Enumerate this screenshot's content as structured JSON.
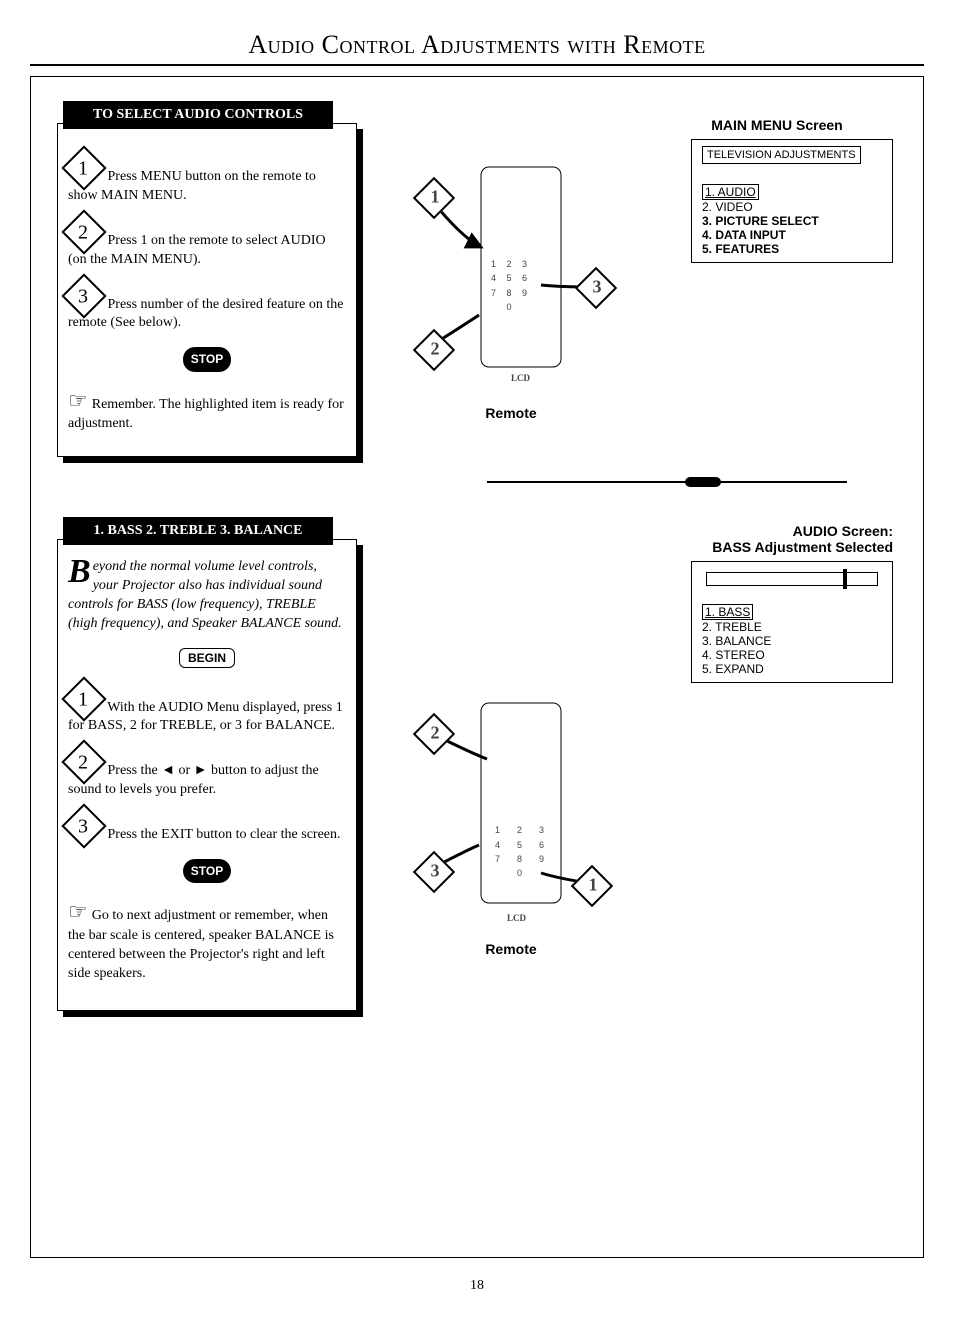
{
  "title": "Audio Control Adjustments with Remote",
  "page_number": "18",
  "section1": {
    "heading": "TO SELECT AUDIO CONTROLS",
    "step1": "Press MENU button on the remote to show MAIN MENU.",
    "step2": "Press 1 on the remote to select AUDIO (on the MAIN MENU).",
    "step3": "Press number of the desired feature on the remote (See below).",
    "stop": "STOP",
    "note": "Remember. The highlighted item is ready for adjustment."
  },
  "main_menu": {
    "label": "MAIN MENU Screen",
    "header": "TELEVISION ADJUSTMENTS",
    "items": [
      "1. AUDIO",
      "2. VIDEO",
      "3. PICTURE SELECT",
      "4. DATA INPUT",
      "5. FEATURES"
    ]
  },
  "remote_label": "Remote",
  "remote_brand": "LCD",
  "section2": {
    "heading": "1. BASS  2. TREBLE  3. BALANCE",
    "intro_dropcap": "B",
    "intro": "eyond the normal volume level controls, your Projector also has individual sound controls for BASS (low frequency), TREBLE (high frequency), and Speaker BALANCE sound.",
    "begin": "BEGIN",
    "step1": "With the AUDIO Menu displayed, press 1 for BASS, 2 for TREBLE, or 3 for BALANCE.",
    "step2": "Press the ◄ or ► button to adjust the sound to levels you prefer.",
    "step3": "Press the EXIT button to clear the screen.",
    "stop": "STOP",
    "note": "Go to next adjustment or remember, when the bar scale is centered, speaker BALANCE is centered between the Projector's right and left side speakers."
  },
  "audio_menu": {
    "label_line1": "AUDIO Screen:",
    "label_line2": "BASS Adjustment Selected",
    "items": [
      "1. BASS",
      "2. TREBLE",
      "3. BALANCE",
      "4. STEREO",
      "5. EXPAND"
    ]
  }
}
